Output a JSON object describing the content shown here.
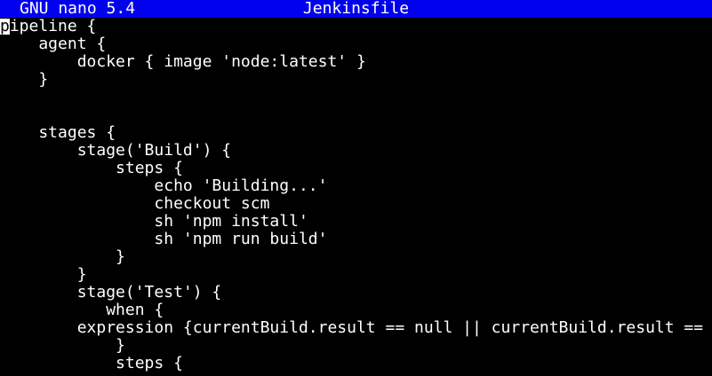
{
  "app": {
    "name_version": "GNU nano 5.4",
    "filename": "Jenkinsfile"
  },
  "colors": {
    "title_bar_bg": "#0000ee",
    "editor_bg": "#000000",
    "text": "#ffffff"
  },
  "editor": {
    "lines": [
      "pipeline {",
      "    agent {",
      "        docker { image 'node:latest' }",
      "    }",
      "",
      "",
      "    stages {",
      "        stage('Build') {",
      "            steps {",
      "                echo 'Building...'",
      "                checkout scm",
      "                sh 'npm install'",
      "                sh 'npm run build'",
      "            }",
      "        }",
      "        stage('Test') {",
      "           when {",
      "        expression {currentBuild.result == null || currentBuild.result == 'SUCCESS'}",
      "            }",
      "            steps {"
    ]
  }
}
